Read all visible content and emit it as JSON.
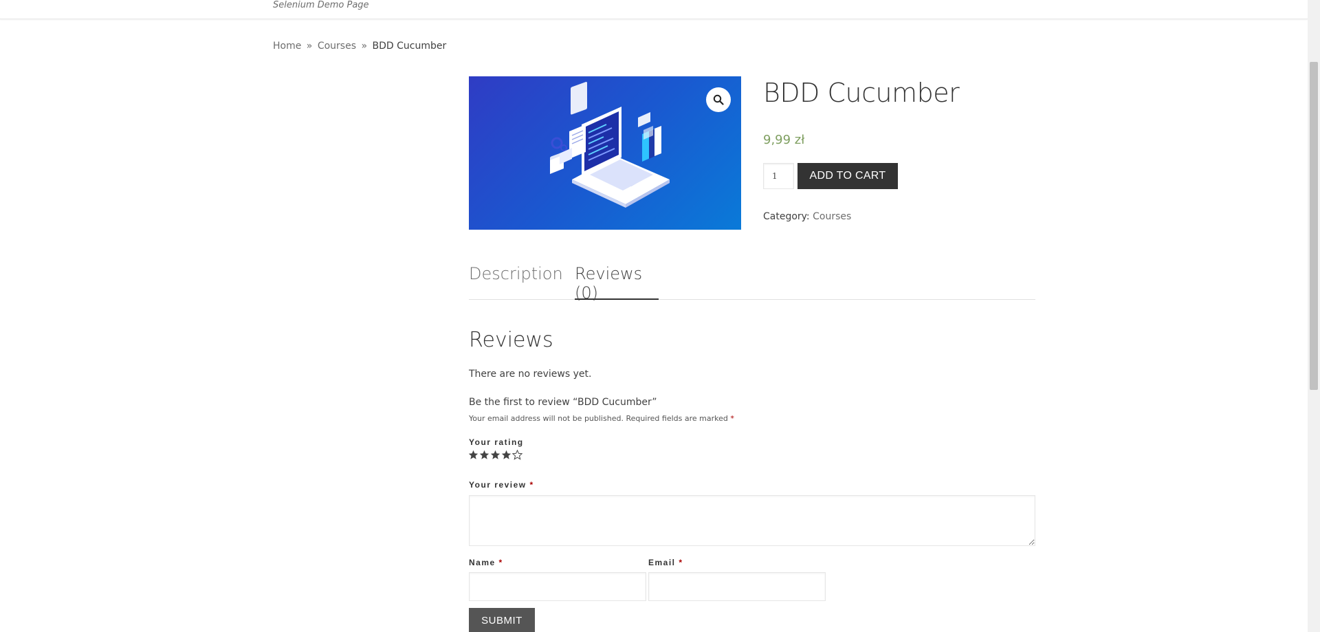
{
  "header": {
    "site_description": "Selenium Demo Page"
  },
  "breadcrumb": {
    "home": "Home",
    "separator": "»",
    "courses": "Courses",
    "current": "BDD Cucumber"
  },
  "product": {
    "title": "BDD Cucumber",
    "price": "9,99 zł",
    "quantity": "1",
    "add_to_cart": "ADD TO CART",
    "category_label": "Category:",
    "category_value": "Courses",
    "image_icon": "laptop-illustration",
    "zoom_icon": "magnifier-icon"
  },
  "tabs": [
    {
      "label": "Description",
      "active": false
    },
    {
      "label": "Reviews (0)",
      "active": true
    }
  ],
  "reviews": {
    "heading": "Reviews",
    "empty_text": "There are no reviews yet.",
    "be_first": "Be the first to review “BDD Cucumber”",
    "notes": "Your email address will not be published. Required fields are marked",
    "required_mark": "*",
    "rating_label": "Your rating",
    "rating_value": 4,
    "rating_max": 5,
    "review_label": "Your review",
    "name_label": "Name",
    "email_label": "Email",
    "submit_label": "SUBMIT"
  },
  "colors": {
    "price": "#7f9f60",
    "button_dark": "#333333",
    "submit_bg": "#555555",
    "required": "#aa0000"
  }
}
